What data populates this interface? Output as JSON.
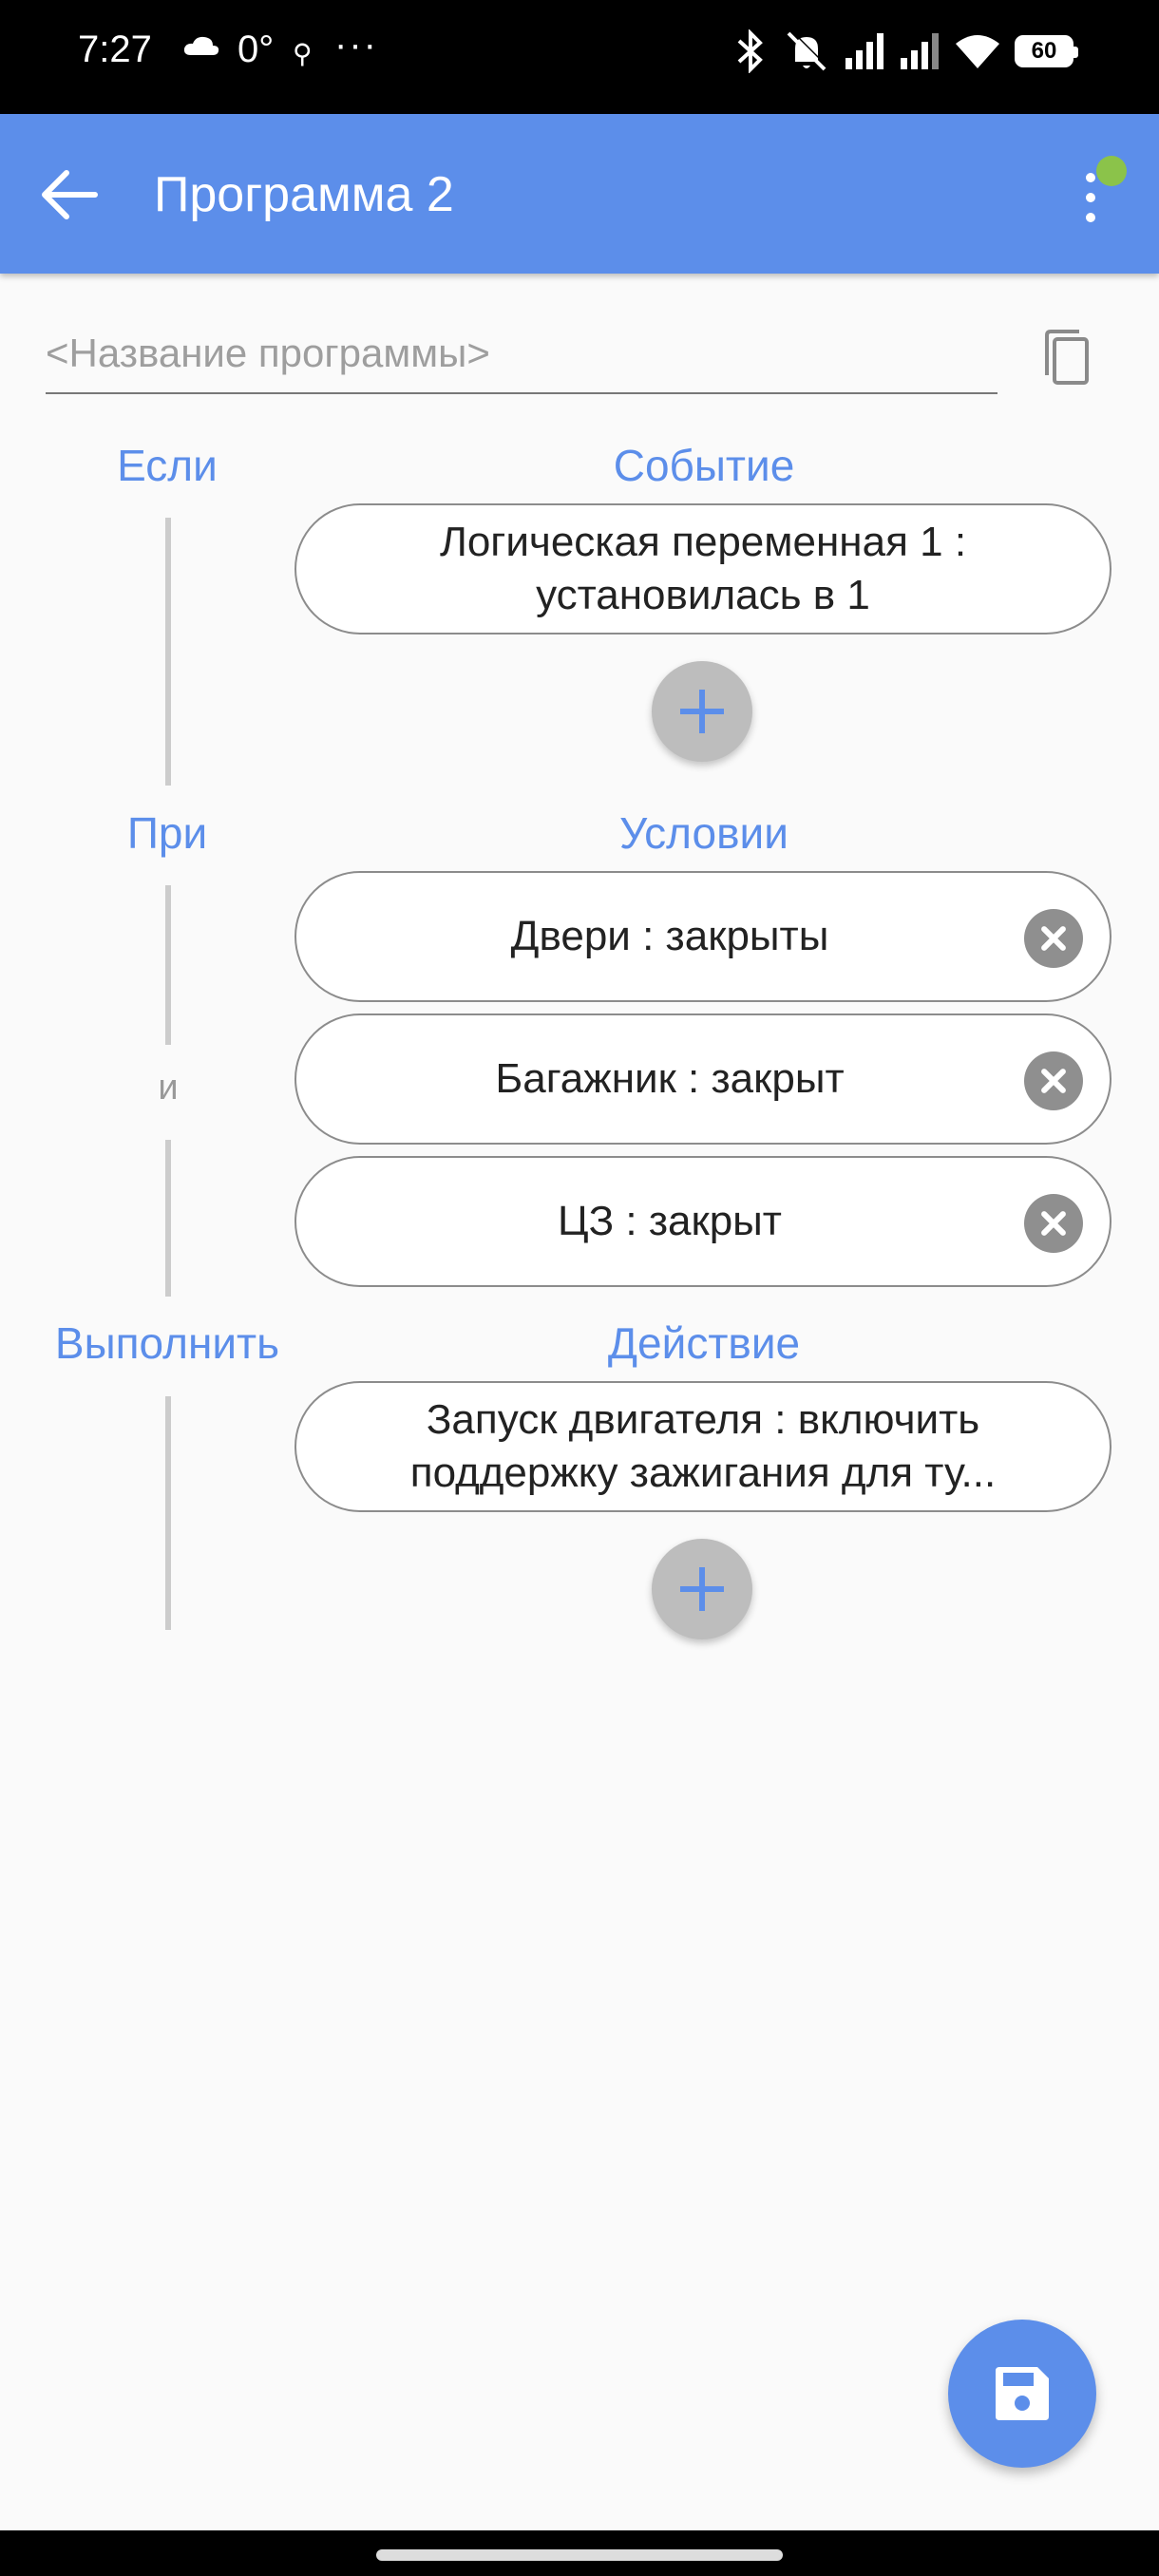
{
  "status_bar": {
    "time": "7:27",
    "temperature": "0°",
    "overflow": "···",
    "battery": "60"
  },
  "app_bar": {
    "title": "Программа 2",
    "status_dot_color": "#8bc34a"
  },
  "program_name": {
    "placeholder": "<Название программы>",
    "value": ""
  },
  "sections": {
    "if_label": "Если",
    "event_header": "Событие",
    "when_label": "При",
    "condition_header": "Условии",
    "and_label": "и",
    "do_label": "Выполнить",
    "action_header": "Действие"
  },
  "events": [
    {
      "text": "Логическая переменная 1 :\nустановилась в 1"
    }
  ],
  "conditions": [
    {
      "text": "Двери : закрыты"
    },
    {
      "text": "Багажник : закрыт"
    },
    {
      "text": "ЦЗ : закрыт"
    }
  ],
  "actions": [
    {
      "text": "Запуск двигателя : включить\nподдержку зажигания для ту..."
    }
  ],
  "colors": {
    "accent": "#5c8eea",
    "add_button": "#bdbdbd",
    "remove_button": "#8f8f8f"
  }
}
